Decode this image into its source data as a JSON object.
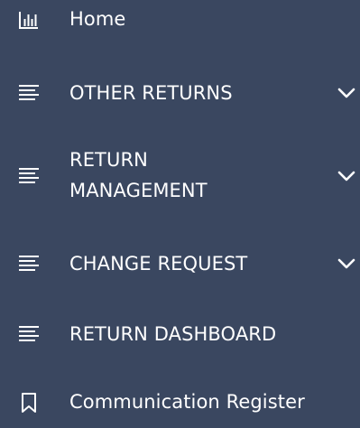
{
  "colors": {
    "background": "#3a4760",
    "text": "#ffffff"
  },
  "menu": {
    "items": [
      {
        "label": "Home",
        "icon": "bar-chart-icon",
        "has_submenu": false
      },
      {
        "label": "OTHER RETURNS",
        "icon": "list-lines-icon",
        "has_submenu": true,
        "chevron": "chevron-down-icon"
      },
      {
        "label": "RETURN MANAGEMENT",
        "icon": "list-lines-icon",
        "has_submenu": true,
        "chevron": "chevron-down-icon"
      },
      {
        "label": "CHANGE REQUEST",
        "icon": "list-lines-icon",
        "has_submenu": true,
        "chevron": "chevron-down-icon"
      },
      {
        "label": "RETURN DASHBOARD",
        "icon": "list-lines-icon",
        "has_submenu": false
      },
      {
        "label": "Communication Register",
        "icon": "bookmark-icon",
        "has_submenu": false
      }
    ]
  }
}
